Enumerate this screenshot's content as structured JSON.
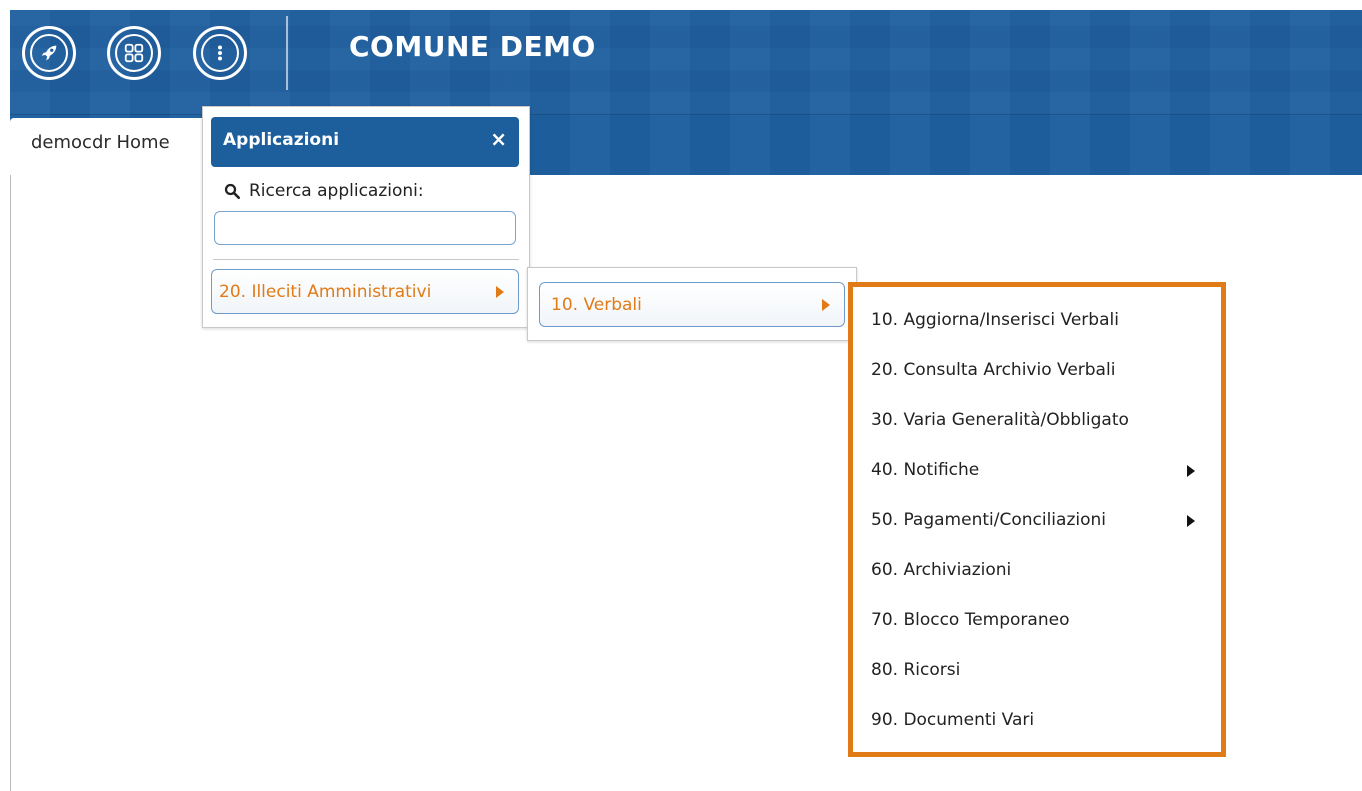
{
  "header": {
    "title": "COMUNE DEMO",
    "icons": [
      "rocket-icon",
      "apps-grid-icon",
      "more-vertical-icon"
    ],
    "background_color": "#1f5f9f"
  },
  "tabs": [
    {
      "label": "democdr Home"
    }
  ],
  "apps_popup": {
    "title": "Applicazioni",
    "close_label": "×",
    "search_label": "Ricerca applicazioni:",
    "search_value": "",
    "items": [
      {
        "label": "20. Illeciti Amministrativi",
        "has_submenu": true
      }
    ]
  },
  "verbali_popup": {
    "items": [
      {
        "label": "10. Verbali",
        "has_submenu": true
      }
    ]
  },
  "submenu": {
    "highlight_color": "#e07b17",
    "items": [
      {
        "label": "10. Aggiorna/Inserisci Verbali",
        "has_submenu": false
      },
      {
        "label": "20. Consulta Archivio Verbali",
        "has_submenu": false
      },
      {
        "label": "30. Varia Generalità/Obbligato",
        "has_submenu": false
      },
      {
        "label": "40. Notifiche",
        "has_submenu": true
      },
      {
        "label": "50. Pagamenti/Conciliazioni",
        "has_submenu": true
      },
      {
        "label": "60. Archiviazioni",
        "has_submenu": false
      },
      {
        "label": "70. Blocco Temporaneo",
        "has_submenu": false
      },
      {
        "label": "80. Ricorsi",
        "has_submenu": false
      },
      {
        "label": "90. Documenti Vari",
        "has_submenu": false
      }
    ]
  }
}
